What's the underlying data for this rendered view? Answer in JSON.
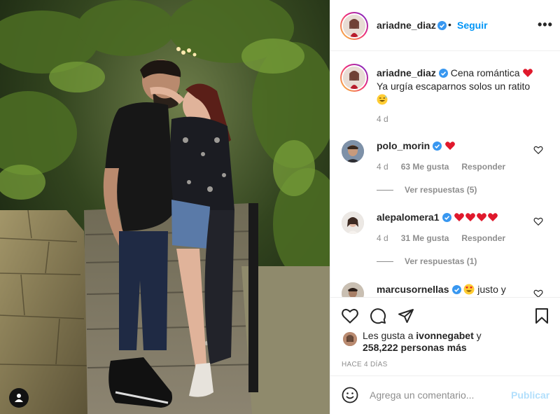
{
  "post": {
    "author": "ariadne_diaz",
    "follow_label": "Seguir",
    "more_label": "•••",
    "dot": "•"
  },
  "caption": {
    "username": "ariadne_diaz",
    "line1": "Cena romántica",
    "line2": "Ya urgía escaparnos solos un ratito",
    "age": "4 d"
  },
  "comments": [
    {
      "username": "polo_morin",
      "text": "",
      "age": "4 d",
      "likes": "63 Me gusta",
      "reply_label": "Responder",
      "view_replies": "Ver respuestas (5)"
    },
    {
      "username": "alepalomera1",
      "text": "",
      "age": "4 d",
      "likes": "31 Me gusta",
      "reply_label": "Responder",
      "view_replies": "Ver respuestas (1)"
    },
    {
      "username": "marcusornellas",
      "text": "justo y"
    }
  ],
  "likes": {
    "prefix": "Les gusta a",
    "user": "ivonnegabet",
    "suffix": "y",
    "count": "258,222 personas más"
  },
  "date_label": "HACE 4 DÍAS",
  "comment_box": {
    "placeholder": "Agrega un comentario...",
    "publish_label": "Publicar"
  },
  "colors": {
    "accent": "#0095f6",
    "publish_disabled": "#b2dffc",
    "heart": "#ed4956",
    "verified": "#3897f0"
  },
  "icons": [
    "user-tag-icon",
    "verified-icon",
    "more-icon",
    "heart-icon",
    "comment-icon",
    "share-icon",
    "bookmark-icon",
    "smile-icon"
  ]
}
